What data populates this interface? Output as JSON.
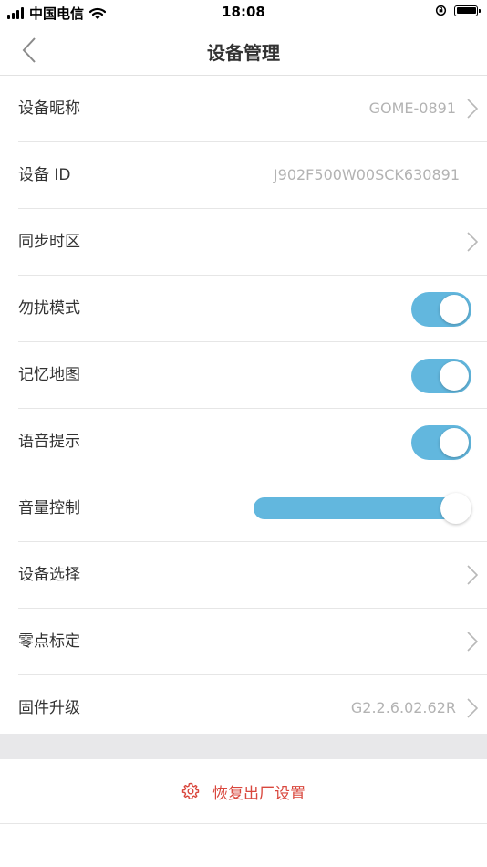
{
  "status_bar": {
    "carrier": "中国电信",
    "time": "18:08"
  },
  "nav": {
    "title": "设备管理"
  },
  "rows": {
    "nickname": {
      "label": "设备昵称",
      "value": "GOME-0891"
    },
    "device_id": {
      "label": "设备 ID",
      "value": "J902F500W00SCK630891"
    },
    "timezone": {
      "label": "同步时区"
    },
    "dnd": {
      "label": "勿扰模式",
      "on": true
    },
    "memory_map": {
      "label": "记忆地图",
      "on": true
    },
    "voice_prompt": {
      "label": "语音提示",
      "on": true
    },
    "volume": {
      "label": "音量控制",
      "level": 1.0
    },
    "device_select": {
      "label": "设备选择"
    },
    "zero_calibration": {
      "label": "零点标定"
    },
    "firmware": {
      "label": "固件升级",
      "value": "G2.2.6.02.62R"
    }
  },
  "reset": {
    "label": "恢复出厂设置"
  },
  "colors": {
    "accent": "#62b7de",
    "danger": "#d9473d",
    "secondary_text": "#b3b3b3"
  },
  "icons": [
    "signal-icon",
    "wifi-icon",
    "orientation-lock-icon",
    "battery-icon",
    "back-chevron-icon",
    "chevron-right-icon",
    "gear-icon"
  ]
}
